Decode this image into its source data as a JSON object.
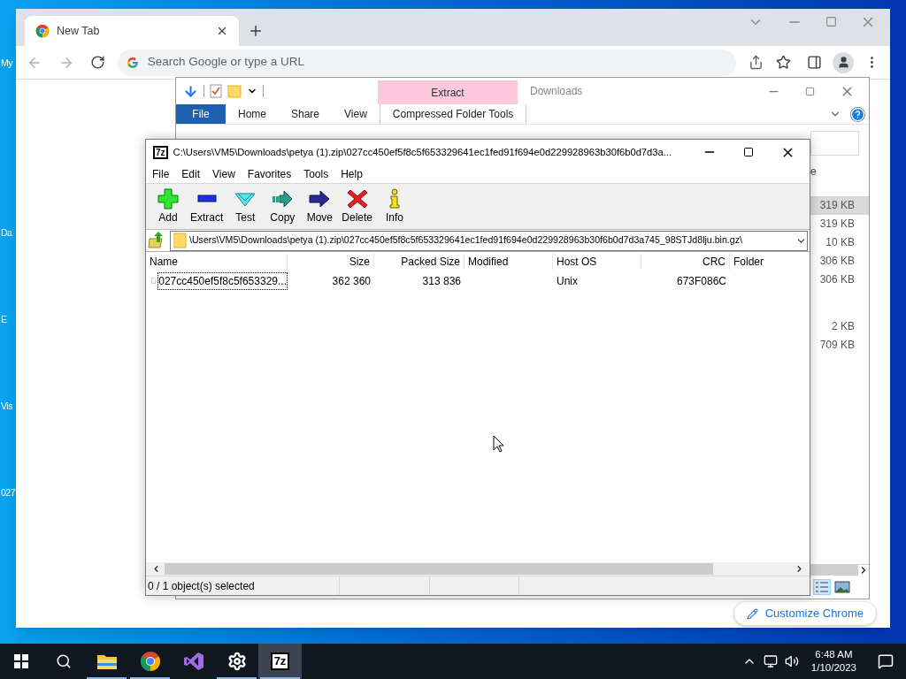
{
  "desktop": {
    "icon_labels": [
      "My",
      "Da",
      "E",
      "Vis",
      "027"
    ]
  },
  "browser": {
    "tabs": [
      {
        "label": "New Tab",
        "selected": true
      }
    ],
    "omnibox": {
      "placeholder": "Search Google or type a URL"
    },
    "customize_button": "Customize Chrome"
  },
  "explorer": {
    "context_tab": "Extract",
    "title": "Downloads",
    "ribbon_tabs": [
      {
        "label": "File",
        "kind": "file"
      },
      {
        "label": "Home",
        "kind": "tab"
      },
      {
        "label": "Share",
        "kind": "tab"
      },
      {
        "label": "View",
        "kind": "tab"
      },
      {
        "label": "Compressed Folder Tools",
        "kind": "context"
      }
    ],
    "header_fragment": "e",
    "size_groups": [
      [
        {
          "size": "319 KB",
          "selected": true
        },
        {
          "size": "319 KB",
          "selected": false
        },
        {
          "size": "10 KB",
          "selected": false
        },
        {
          "size": "306 KB",
          "selected": false
        },
        {
          "size": "306 KB",
          "selected": false
        }
      ],
      [
        {
          "size": "2 KB",
          "selected": false
        },
        {
          "size": "709 KB",
          "selected": false
        }
      ]
    ]
  },
  "archiver": {
    "icon_text": "7z",
    "title": "C:\\Users\\VM5\\Downloads\\petya (1).zip\\027cc450ef5f8c5f653329641ec1fed91f694e0d229928963b30f6b0d7d3a...",
    "menu": [
      "File",
      "Edit",
      "View",
      "Favorites",
      "Tools",
      "Help"
    ],
    "toolbar": [
      {
        "label": "Add",
        "kind": "add"
      },
      {
        "label": "Extract",
        "kind": "extract"
      },
      {
        "label": "Test",
        "kind": "test"
      },
      {
        "label": "Copy",
        "kind": "copy"
      },
      {
        "label": "Move",
        "kind": "move"
      },
      {
        "label": "Delete",
        "kind": "delete"
      },
      {
        "label": "Info",
        "kind": "info"
      }
    ],
    "path": "\\Users\\VM5\\Downloads\\petya (1).zip\\027cc450ef5f8c5f653329641ec1fed91f694e0d229928963b30f6b0d7d3a745_98STJd8lju.bin.gz\\",
    "columns": [
      {
        "label": "Name"
      },
      {
        "label": "Size"
      },
      {
        "label": "Packed Size"
      },
      {
        "label": "Modified"
      },
      {
        "label": "Host OS"
      },
      {
        "label": "CRC"
      },
      {
        "label": "Folder"
      }
    ],
    "rows": [
      {
        "name": "027cc450ef5f8c5f653329...",
        "size": "362 360",
        "packed_size": "313 836",
        "host_os": "Unix",
        "crc": "673F086C",
        "focused": true
      }
    ],
    "status": "0 / 1 object(s) selected"
  },
  "taskbar": {
    "apps": [
      {
        "kind": "explorer",
        "running": true,
        "active": false
      },
      {
        "kind": "chrome",
        "running": true,
        "active": false
      },
      {
        "kind": "visual-studio",
        "running": false,
        "active": false
      },
      {
        "kind": "settings",
        "running": true,
        "active": false
      },
      {
        "kind": "archiver",
        "label": "7z",
        "running": true,
        "active": true
      }
    ],
    "time": "6:48 AM",
    "date": "1/10/2023"
  }
}
